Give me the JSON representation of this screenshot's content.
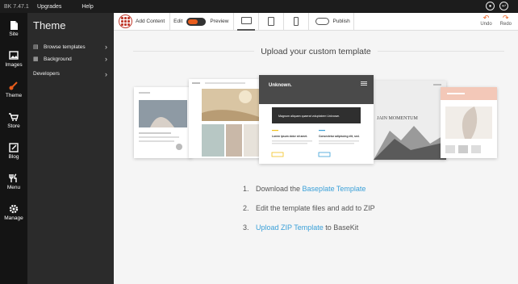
{
  "topbar": {
    "version": "BK 7.47.1",
    "menu": [
      "Upgrades",
      "Help"
    ]
  },
  "rail": {
    "items": [
      {
        "label": "Site",
        "icon": "file-icon"
      },
      {
        "label": "Images",
        "icon": "image-icon"
      },
      {
        "label": "Theme",
        "icon": "paintbrush-icon"
      },
      {
        "label": "Store",
        "icon": "cart-icon"
      },
      {
        "label": "Blog",
        "icon": "edit-icon"
      },
      {
        "label": "Menu",
        "icon": "utensils-icon"
      },
      {
        "label": "Manage",
        "icon": "gear-icon"
      }
    ],
    "active": "Theme",
    "accent": "#e85c1c"
  },
  "panel": {
    "title": "Theme",
    "items": [
      {
        "label": "Browse templates",
        "icon": "browser-icon"
      },
      {
        "label": "Background",
        "icon": "grid-icon"
      },
      {
        "label": "Developers",
        "icon": ""
      }
    ]
  },
  "toolbar": {
    "add_content": "Add Content",
    "edit": "Edit",
    "preview": "Preview",
    "publish": "Publish",
    "undo": "Undo",
    "redo": "Redo"
  },
  "main": {
    "heading": "Upload your custom template",
    "preview_template": {
      "brand": "Unknown.",
      "banner": "Magnum aliquam quaerat voluptatem Unknown.",
      "col1": "Lorem ipsum dolor sit amet.",
      "col2": "Consectetur adipiscing elit, sed."
    },
    "momentum_title": "JAIN MOMENTUM",
    "steps": [
      {
        "num": "1.",
        "pre": "Download the ",
        "link": "Baseplate Template",
        "post": ""
      },
      {
        "num": "2.",
        "pre": "Edit the template files and add to ZIP",
        "link": "",
        "post": ""
      },
      {
        "num": "3.",
        "pre": "",
        "link": "Upload ZIP Template",
        "post": " to BaseKit"
      }
    ],
    "link_color": "#3aa0d8"
  }
}
